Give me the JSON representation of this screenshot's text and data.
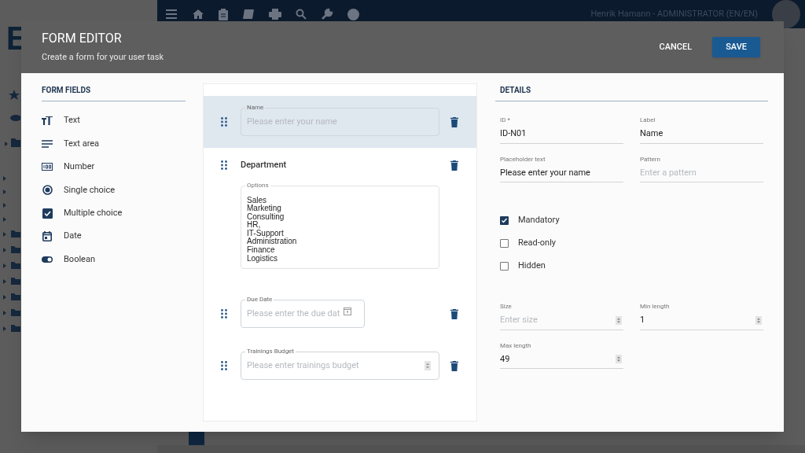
{
  "app": {
    "logo_letter": "E",
    "user": "Henrik Hamann - ADMINISTRATOR (EN/EN)"
  },
  "dialog": {
    "title": "FORM EDITOR",
    "subtitle": "Create a form for your user task",
    "buttons": [
      {
        "label": "CANCEL",
        "kind": "text"
      },
      {
        "label": "SAVE",
        "kind": "primary"
      }
    ]
  },
  "form_fields": {
    "title": "FORM FIELDS",
    "items": [
      {
        "label": "Text",
        "kind": "text"
      },
      {
        "label": "Text area",
        "kind": "textarea"
      },
      {
        "label": "Number",
        "kind": "number"
      },
      {
        "label": "Single choice",
        "kind": "single"
      },
      {
        "label": "Multiple choice",
        "kind": "multiple"
      },
      {
        "label": "Date",
        "kind": "date"
      },
      {
        "label": "Boolean",
        "kind": "boolean"
      }
    ]
  },
  "form": {
    "fields": [
      {
        "kind": "text",
        "label": "Name",
        "placeholder": "Please enter your name",
        "selected": true
      },
      {
        "kind": "options",
        "title": "Department",
        "label": "Options",
        "options": [
          "Sales",
          "Marketing",
          "Consulting",
          "HR,",
          "IT-Support",
          "Administration",
          "Finance",
          "Logistics"
        ],
        "selected": false
      },
      {
        "kind": "date",
        "label": "Due Date",
        "placeholder": "Please enter the due dat",
        "selected": false
      },
      {
        "kind": "number",
        "label": "Trainings Budget",
        "placeholder": "Please enter trainings budget",
        "selected": false
      }
    ]
  },
  "details": {
    "title": "DETAILS",
    "text_fields": [
      {
        "label": "ID *",
        "value": "ID-N01"
      },
      {
        "label": "Label",
        "value": "Name"
      },
      {
        "label": "Placeholder text",
        "value": "Please enter your name"
      },
      {
        "label": "Pattern",
        "placeholder": "Enter a pattern"
      }
    ],
    "checkboxes": [
      {
        "label": "Mandatory",
        "checked": true
      },
      {
        "label": "Read-only",
        "checked": false
      },
      {
        "label": "Hidden",
        "checked": false
      }
    ],
    "number_fields": [
      {
        "label": "Size",
        "placeholder": "Enter size"
      },
      {
        "label": "Min length",
        "value": "1"
      },
      {
        "label": "Max length",
        "value": "49"
      }
    ]
  }
}
